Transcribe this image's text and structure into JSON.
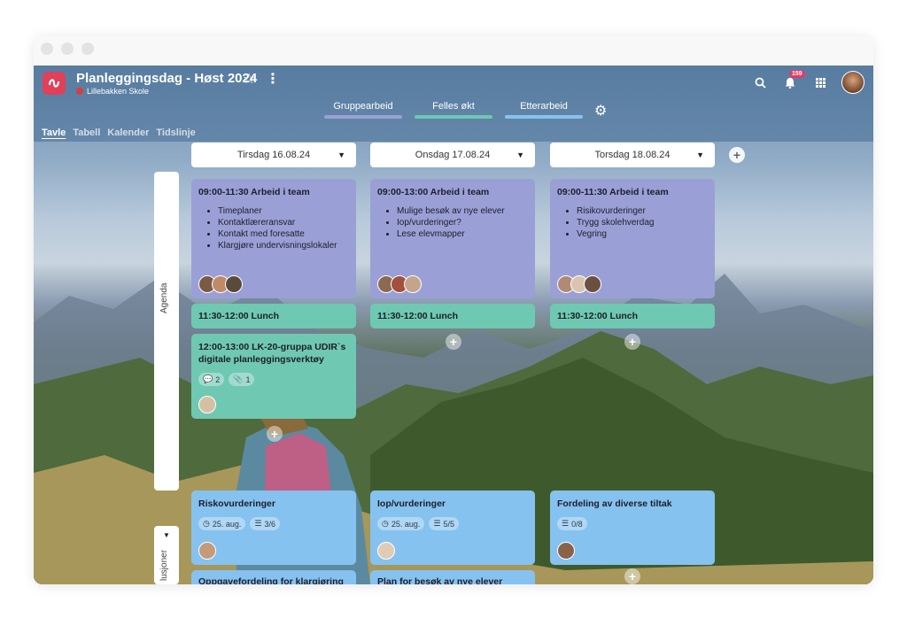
{
  "app": {
    "title": "Planleggingsdag - Høst 2024",
    "subtitle": "Lillebakken Skole",
    "notification_count": "159",
    "accent_color": "#e0405a"
  },
  "groups": [
    {
      "label": "Gruppearbeid",
      "color": "#9aa0d6"
    },
    {
      "label": "Felles økt",
      "color": "#6fc8b2"
    },
    {
      "label": "Etterarbeid",
      "color": "#86c2ef"
    }
  ],
  "tabs": [
    "Tavle",
    "Tabell",
    "Kalender",
    "Tidslinje"
  ],
  "days": [
    "Tirsdag 16.08.24",
    "Onsdag 17.08.24",
    "Torsdag 18.08.24"
  ],
  "swimlanes": {
    "agenda": "Agenda",
    "second": "lusjoner"
  },
  "agenda": {
    "col1": {
      "teamwork": {
        "title": "09:00-11:30 Arbeid i team",
        "items": [
          "Timeplaner",
          "Kontaktlæreransvar",
          "Kontakt med foresatte",
          "Klargjøre undervisningslokaler"
        ]
      },
      "lunch": "11:30-12:00 Lunch",
      "extra": {
        "title": "12:00-13:00 LK-20-gruppa UDIR`s digitale planleggingsverktøy",
        "comments": "2",
        "attachments": "1"
      }
    },
    "col2": {
      "teamwork": {
        "title": "09:00-13:00 Arbeid i team",
        "items": [
          "Mulige besøk av nye elever",
          "Iop/vurderinger?",
          "Lese elevmapper"
        ]
      },
      "lunch": "11:30-12:00 Lunch"
    },
    "col3": {
      "teamwork": {
        "title": "09:00-11:30 Arbeid i team",
        "items": [
          "Risikovurderinger",
          "Trygg skolehverdag",
          "Vegring"
        ]
      },
      "lunch": "11:30-12:00 Lunch"
    }
  },
  "tasks": {
    "col1": {
      "title": "Riskovurderinger",
      "date": "25. aug.",
      "checklist": "3/6",
      "next": "Oppgavefordeling for klargjøring"
    },
    "col2": {
      "title": "Iop/vurderinger",
      "date": "25. aug.",
      "checklist": "5/5",
      "next": "Plan for besøk av nye elever"
    },
    "col3": {
      "title": "Fordeling av diverse tiltak",
      "checklist": "0/8"
    }
  }
}
